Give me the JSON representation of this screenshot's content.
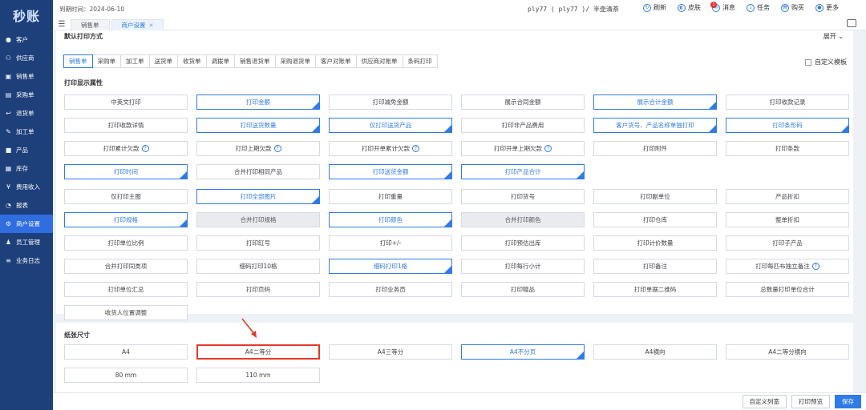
{
  "app": {
    "logo": "秒账",
    "expire": "到期时间：2024-06-10",
    "user": "ply77 ( ply77 )/ 半壶清茶"
  },
  "sidebar": [
    {
      "label": "客户",
      "icon": "person-icon"
    },
    {
      "label": "供应商",
      "icon": "people-icon"
    },
    {
      "label": "销售单",
      "icon": "cart-icon"
    },
    {
      "label": "采购单",
      "icon": "cart-in-icon"
    },
    {
      "label": "退货单",
      "icon": "return-icon"
    },
    {
      "label": "加工单",
      "icon": "tool-icon"
    },
    {
      "label": "产品",
      "icon": "box-icon"
    },
    {
      "label": "库存",
      "icon": "warehouse-icon"
    },
    {
      "label": "费用收入",
      "icon": "money-icon"
    },
    {
      "label": "报表",
      "icon": "pie-icon"
    },
    {
      "label": "商户设置",
      "icon": "settings-icon",
      "active": true
    },
    {
      "label": "员工管理",
      "icon": "staff-icon"
    },
    {
      "label": "业务日志",
      "icon": "log-icon"
    }
  ],
  "tabs": [
    "销售单",
    "商户设置"
  ],
  "topbar_buttons": [
    "刷新",
    "皮肤",
    "消息",
    "任务",
    "购买",
    "更多"
  ],
  "message_badge": "1",
  "section1": {
    "title": "默认打印方式",
    "toggle": "展开",
    "subtabs": [
      "销售单",
      "采购单",
      "加工单",
      "送货单",
      "收货单",
      "调拨单",
      "销售退货单",
      "采购退货单",
      "客户对账单",
      "供应商对账单",
      "条码打印"
    ],
    "custom_template": "自定义模板",
    "attr_title": "打印显示属性"
  },
  "group1": [
    {
      "label": "中英文打印"
    },
    {
      "label": "打印金额",
      "sel": true
    },
    {
      "label": "打印减免金额"
    },
    {
      "label": "展示合同金额"
    },
    {
      "label": "展示合计金额",
      "sel": true
    },
    {
      "label": "打印收款记录"
    },
    {
      "label": "打印收款详情"
    },
    {
      "label": "打印送货数量",
      "sel": true
    },
    {
      "label": "仅打印送货产品",
      "sel": true
    },
    {
      "label": "打印非产品费用"
    },
    {
      "label": "客户货号、产品名称单独打印",
      "sel": true
    },
    {
      "label": "打印条形码",
      "sel": true
    },
    {
      "label": "打印累计欠款",
      "q": true
    },
    {
      "label": "打印上期欠款",
      "q": true
    },
    {
      "label": "打印开单累计欠款",
      "q": true
    },
    {
      "label": "打印开单上期欠款",
      "q": true
    },
    {
      "label": "打印附件"
    },
    {
      "label": "打印条款"
    },
    {
      "label": "打印时间",
      "sel": true
    },
    {
      "label": "合并打印相同产品"
    },
    {
      "label": "打印送货金额",
      "sel": true
    },
    {
      "label": "打印产品合计",
      "sel": true
    }
  ],
  "group2": [
    {
      "label": "仅打印主图"
    },
    {
      "label": "打印全部图片",
      "sel": true
    },
    {
      "label": "打印重量"
    },
    {
      "label": "打印货号"
    },
    {
      "label": "打印副单位"
    },
    {
      "label": "产品折扣"
    },
    {
      "label": "打印规格",
      "sel": true
    },
    {
      "label": "合并打印规格",
      "dis": true
    },
    {
      "label": "打印颜色",
      "sel": true
    },
    {
      "label": "合并打印颜色",
      "dis": true
    },
    {
      "label": "打印仓库"
    },
    {
      "label": "整单折扣"
    },
    {
      "label": "打印单位比例"
    },
    {
      "label": "打印缸号"
    },
    {
      "label": "打印+/-"
    },
    {
      "label": "打印预估出库"
    },
    {
      "label": "打印计价数量"
    },
    {
      "label": "打印子产品"
    },
    {
      "label": "合并打印同类项"
    },
    {
      "label": "细码打印10格"
    },
    {
      "label": "细码打印1格",
      "sel": true
    },
    {
      "label": "打印每行小计"
    },
    {
      "label": "打印备注"
    },
    {
      "label": "打印每匹布独立备注",
      "q": true
    },
    {
      "label": "打印单位汇总"
    },
    {
      "label": "打印页码"
    },
    {
      "label": "打印业务员"
    },
    {
      "label": "打印赠品"
    },
    {
      "label": "打印单据二维码"
    },
    {
      "label": "总数量打印单位合计"
    },
    {
      "label": "收货人位置调整"
    }
  ],
  "paper": {
    "title": "纸张尺寸",
    "options": [
      {
        "label": "A4"
      },
      {
        "label": "A4二等分",
        "hl": true
      },
      {
        "label": "A4三等分"
      },
      {
        "label": "A4不分页",
        "sel": true
      },
      {
        "label": "A4横向"
      },
      {
        "label": "A4二等分横向"
      },
      {
        "label": "80 mm"
      },
      {
        "label": "110 mm"
      }
    ]
  },
  "bottom_buttons": {
    "custom_cols": "自定义列宽",
    "preview": "打印预览",
    "save": "保存"
  },
  "colors": {
    "primary": "#2f7be8",
    "sidebar": "#1d3f7a",
    "highlight": "#e23a2a"
  }
}
